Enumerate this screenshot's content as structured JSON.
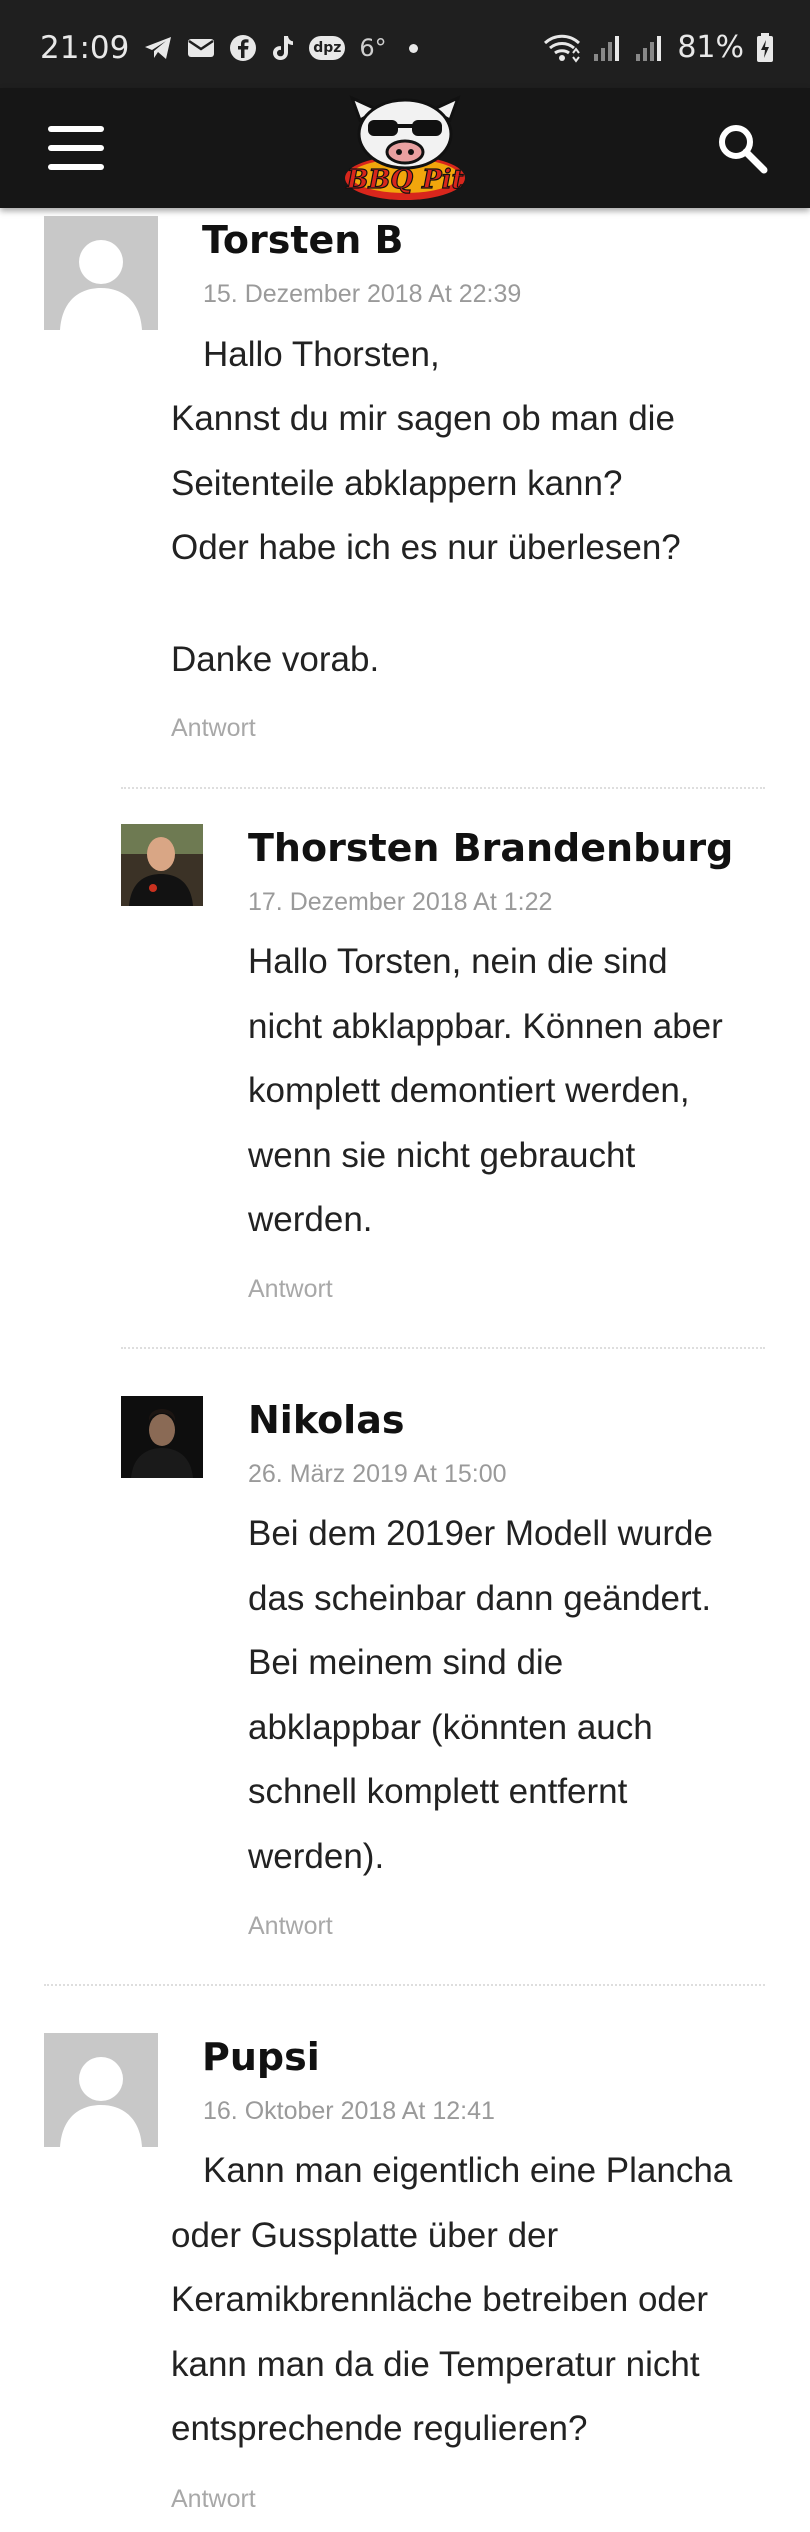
{
  "status_bar": {
    "time": "21:09",
    "temperature": "6°",
    "battery": "81%",
    "icons": [
      "telegram-icon",
      "mail-icon",
      "facebook-icon",
      "tiktok-icon",
      "dpz-icon",
      "dot-icon",
      "wifi-icon",
      "signal-icon",
      "battery-icon"
    ],
    "dpz_text": "dpz"
  },
  "nav": {
    "logo_text": "BBQ Pit",
    "icons": [
      "menu-icon",
      "search-icon"
    ]
  },
  "colors": {
    "navbar": "#161616",
    "statusbar": "#1f1f1f",
    "meta_text": "#9a9a9a"
  },
  "comments": [
    {
      "author": "Torsten B",
      "date": "15. Dezember 2018 At 22:39",
      "lines": [
        "Hallo Thorsten,",
        "Kannst du mir sagen ob man die",
        "Seitenteile abklappern kann?",
        "Oder habe ich es nur überlesen?",
        "Danke vorab."
      ],
      "reply": "Antwort"
    },
    {
      "author": "Thorsten Brandenburg",
      "date": "17. Dezember 2018 At 1:22",
      "lines": [
        "Hallo Torsten, nein die sind",
        "nicht abklappbar. Können aber",
        "komplett demontiert werden,",
        "wenn sie nicht gebraucht",
        "werden."
      ],
      "reply": "Antwort"
    },
    {
      "author": "Nikolas",
      "date": "26. März 2019 At 15:00",
      "lines": [
        "Bei dem 2019er Modell wurde",
        "das scheinbar dann geändert.",
        "Bei meinem sind die",
        "abklappbar (könnten auch",
        "schnell komplett entfernt",
        "werden)."
      ],
      "reply": "Antwort"
    },
    {
      "author": "Pupsi",
      "date": "16. Oktober 2018 At 12:41",
      "lines": [
        "Kann man eigentlich eine Plancha",
        "oder Gussplatte über der",
        "Keramikbrennläche betreiben oder",
        "kann man da die Temperatur nicht",
        "entsprechende regulieren?"
      ],
      "reply": "Antwort"
    }
  ]
}
